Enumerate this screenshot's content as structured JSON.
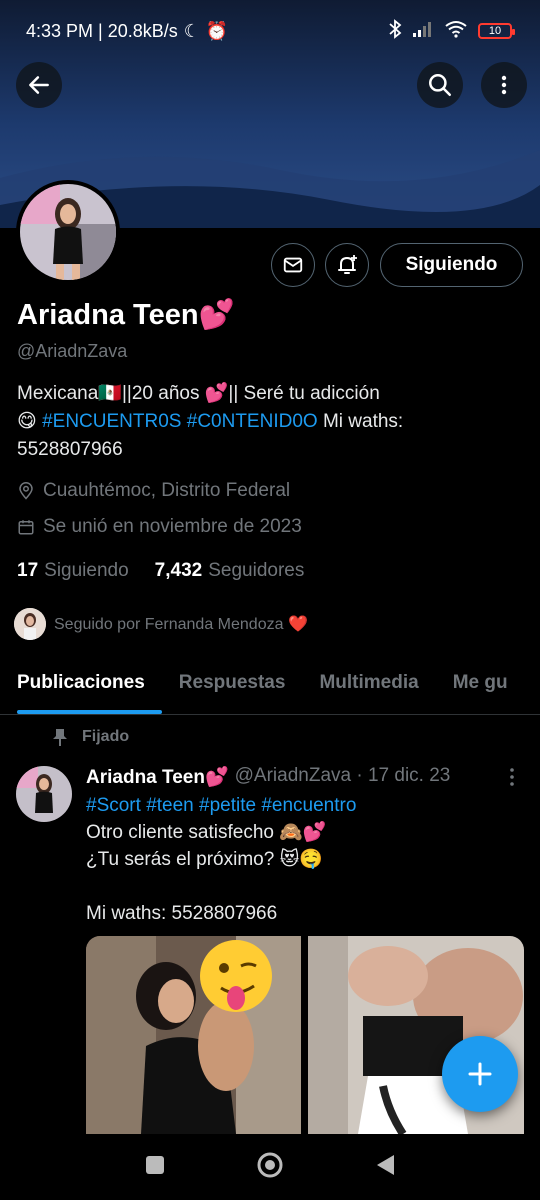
{
  "status_bar": {
    "time_speed": "4:33 PM | 20.8kB/s",
    "battery": "10"
  },
  "header": {
    "back_icon": "arrow-left-icon",
    "search_icon": "search-icon",
    "more_icon": "more-vertical-icon"
  },
  "profile": {
    "name": "Ariadna Teen",
    "name_emoji": "💕",
    "handle": "@AriadnZava",
    "follow_button": "Siguiendo",
    "bio_line1": "Mexicana🇲🇽||20 años 💕|| Seré tu adicción",
    "bio_emoji": "😋",
    "bio_tag1": "#ENCUENTR0S",
    "bio_tag2": "#C0NTENID0O",
    "bio_tail": "Mi waths:",
    "bio_phone": "5528807966",
    "location": "Cuauhtémoc, Distrito Federal",
    "joined": "Se unió en noviembre de 2023",
    "following_count": "17",
    "following_label": "Siguiendo",
    "followers_count": "7,432",
    "followers_label": "Seguidores",
    "followed_by": "Seguido por Fernanda Mendoza ❤️"
  },
  "tabs": [
    {
      "label": "Publicaciones"
    },
    {
      "label": "Respuestas"
    },
    {
      "label": "Multimedia"
    },
    {
      "label": "Me gu"
    }
  ],
  "pinned_post": {
    "pinned_label": "Fijado",
    "author_name": "Ariadna Teen💕",
    "author_meta": "@AriadnZava · 17 dic. 23",
    "hashtags": "#Scort #teen #petite #encuentro",
    "text": "Otro cliente satisfecho 🙈💕\n¿Tu serás el próximo? 😻🤤\n\nMi waths: 5528807966"
  },
  "colors": {
    "accent": "#1d9bf0",
    "background": "#000000",
    "muted": "#71767b"
  }
}
